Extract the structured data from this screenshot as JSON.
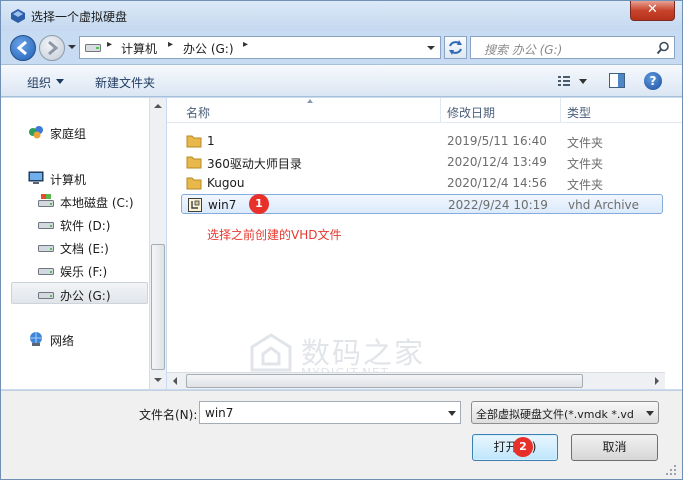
{
  "window": {
    "title": "选择一个虚拟硬盘",
    "close_label": "✕"
  },
  "address": {
    "sep": "▸",
    "crumbs": [
      "计算机",
      "办公 (G:)"
    ]
  },
  "search": {
    "placeholder": "搜索 办公 (G:)"
  },
  "toolbar": {
    "organize_label": "组织",
    "new_folder_label": "新建文件夹",
    "help_label": "?"
  },
  "navpane": {
    "items": [
      {
        "label": "家庭组",
        "icon": "homegroup-icon"
      },
      {
        "label": "计算机",
        "icon": "computer-icon"
      },
      {
        "label": "本地磁盘 (C:)",
        "icon": "system-drive-icon"
      },
      {
        "label": "软件 (D:)",
        "icon": "drive-icon"
      },
      {
        "label": "文档 (E:)",
        "icon": "drive-icon"
      },
      {
        "label": "娱乐 (F:)",
        "icon": "drive-icon"
      },
      {
        "label": "办公 (G:)",
        "icon": "drive-icon",
        "selected": true
      },
      {
        "label": "网络",
        "icon": "network-icon"
      }
    ]
  },
  "filelist": {
    "columns": {
      "name": "名称",
      "modified": "修改日期",
      "type": "类型"
    },
    "rows": [
      {
        "name": "1",
        "modified": "2019/5/11 16:40",
        "type": "文件夹",
        "icon": "folder-icon"
      },
      {
        "name": "360驱动大师目录",
        "modified": "2020/12/4 13:49",
        "type": "文件夹",
        "icon": "folder-icon"
      },
      {
        "name": "Kugou",
        "modified": "2020/12/4 14:56",
        "type": "文件夹",
        "icon": "folder-icon"
      },
      {
        "name": "win7",
        "modified": "2022/9/24 10:19",
        "type": "vhd Archive",
        "icon": "vhd-file-icon",
        "selected": true
      }
    ],
    "annotation": "选择之前创建的VHD文件",
    "badge1": "1"
  },
  "watermark": {
    "main": "数码之家",
    "sub": "MYDIGIT.NET"
  },
  "bottom": {
    "filename_label": "文件名(N):",
    "filename_value": "win7",
    "filter_value": "全部虚拟硬盘文件(*.vmdk *.vd",
    "open_label": "打开(O)",
    "cancel_label": "取消",
    "badge2": "2"
  },
  "colors": {
    "accent": "#3c7fb1",
    "annotation_red": "#e53a2f",
    "selection": "#dbeafc"
  }
}
